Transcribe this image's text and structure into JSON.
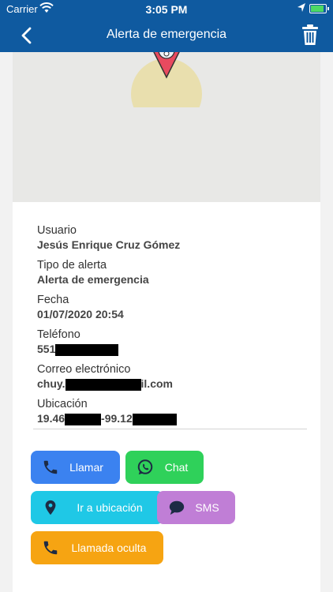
{
  "status_bar": {
    "carrier": "Carrier",
    "time": "3:05 PM"
  },
  "nav": {
    "title": "Alerta de emergencia",
    "back_icon": "chevron-left-icon",
    "delete_icon": "trash-icon"
  },
  "details": {
    "usuario": {
      "label": "Usuario",
      "value": "Jesús Enrique Cruz Gómez"
    },
    "tipo": {
      "label": "Tipo de alerta",
      "value": "Alerta de emergencia"
    },
    "fecha": {
      "label": "Fecha",
      "value": "01/07/2020 20:54"
    },
    "telefono": {
      "label": "Teléfono",
      "value_prefix": "551"
    },
    "correo": {
      "label": "Correo electrónico",
      "value_prefix": "chuy.",
      "value_suffix": "il.com"
    },
    "ubicacion": {
      "label": "Ubicación",
      "value_prefix": "19.46",
      "value_middle": "-99.12"
    }
  },
  "actions": {
    "llamar": {
      "label": "Llamar",
      "color": "#3b82f0"
    },
    "chat": {
      "label": "Chat",
      "color": "#2fd15a"
    },
    "ir_ubicacion": {
      "label": "Ir a ubicación",
      "color": "#1fc8e6"
    },
    "sms": {
      "label": "SMS",
      "color": "#c07ed6"
    },
    "llamada_oculta": {
      "label": "Llamada oculta",
      "color": "#f6a412"
    }
  }
}
